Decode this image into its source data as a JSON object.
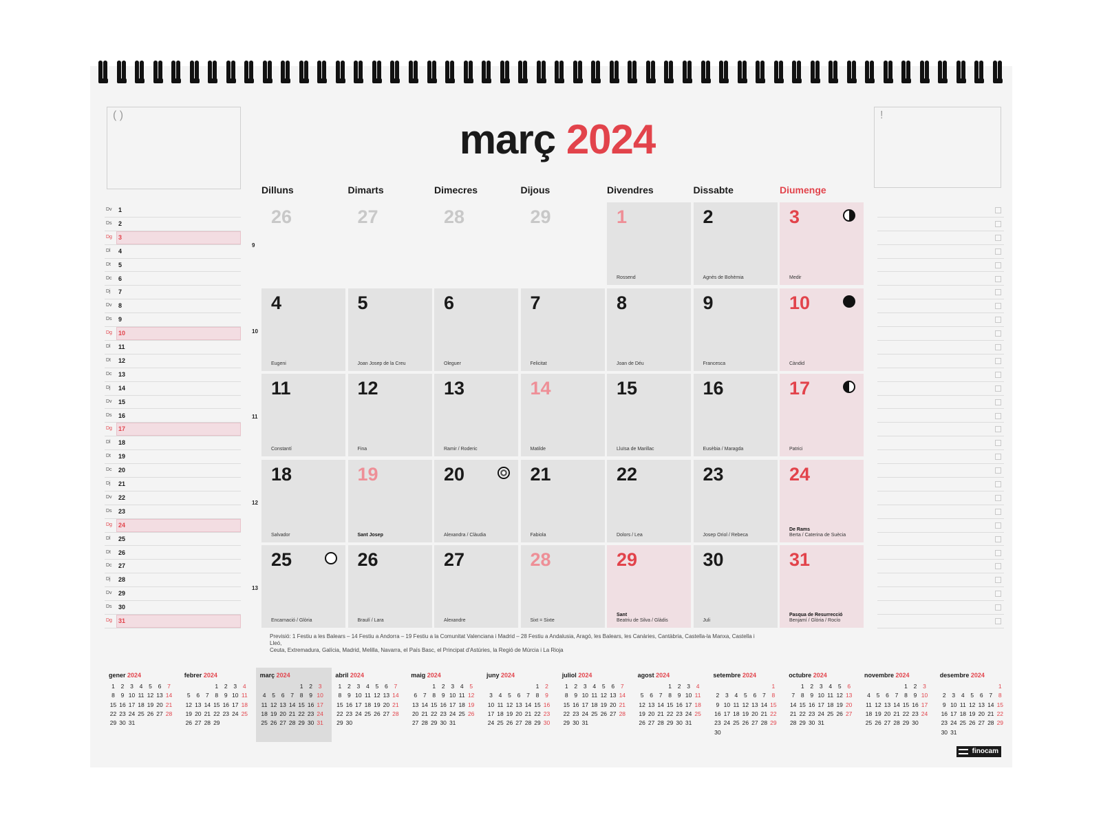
{
  "title": {
    "month": "març",
    "year": "2024"
  },
  "left_box_symbol": "( )",
  "right_box_symbol": "!",
  "weekdays": [
    "Dilluns",
    "Dimarts",
    "Dimecres",
    "Dijous",
    "Divendres",
    "Dissabte",
    "Diumenge"
  ],
  "week_numbers": [
    "9",
    "10",
    "11",
    "12",
    "13"
  ],
  "cells": [
    {
      "num": "26",
      "style": "grey",
      "bg": "empty",
      "saint": ""
    },
    {
      "num": "27",
      "style": "grey",
      "bg": "empty",
      "saint": ""
    },
    {
      "num": "28",
      "style": "grey",
      "bg": "empty",
      "saint": ""
    },
    {
      "num": "29",
      "style": "grey",
      "bg": "empty",
      "saint": ""
    },
    {
      "num": "1",
      "style": "pink",
      "bg": "weekday",
      "saint": "Rossend"
    },
    {
      "num": "2",
      "style": "",
      "bg": "weekday",
      "saint": "Agnès de Bohèmia"
    },
    {
      "num": "3",
      "style": "red",
      "bg": "holiday",
      "saint": "Medir",
      "moon": "half-l"
    },
    {
      "num": "4",
      "style": "",
      "bg": "weekday",
      "saint": "Eugeni"
    },
    {
      "num": "5",
      "style": "",
      "bg": "weekday",
      "saint": "Joan Josep de la Creu"
    },
    {
      "num": "6",
      "style": "",
      "bg": "weekday",
      "saint": "Oleguer"
    },
    {
      "num": "7",
      "style": "",
      "bg": "weekday",
      "saint": "Felicitat"
    },
    {
      "num": "8",
      "style": "",
      "bg": "weekday",
      "saint": "Joan de Déu"
    },
    {
      "num": "9",
      "style": "",
      "bg": "weekday",
      "saint": "Francesca"
    },
    {
      "num": "10",
      "style": "red",
      "bg": "holiday",
      "saint": "Càndid",
      "moon": "full"
    },
    {
      "num": "11",
      "style": "",
      "bg": "weekday",
      "saint": "Constantí"
    },
    {
      "num": "12",
      "style": "",
      "bg": "weekday",
      "saint": "Fina"
    },
    {
      "num": "13",
      "style": "",
      "bg": "weekday",
      "saint": "Ramir / Roderic"
    },
    {
      "num": "14",
      "style": "pink",
      "bg": "weekday",
      "saint": "Matilde"
    },
    {
      "num": "15",
      "style": "",
      "bg": "weekday",
      "saint": "Lluïsa de Marillac"
    },
    {
      "num": "16",
      "style": "",
      "bg": "weekday",
      "saint": "Eusèbia / Maragda"
    },
    {
      "num": "17",
      "style": "red",
      "bg": "holiday",
      "saint": "Patrici",
      "moon": "half-r"
    },
    {
      "num": "18",
      "style": "",
      "bg": "weekday",
      "saint": "Salvador"
    },
    {
      "num": "19",
      "style": "pink",
      "bg": "weekday",
      "saint_bold": "Sant Josep",
      "saint": ""
    },
    {
      "num": "20",
      "style": "",
      "bg": "weekday",
      "saint": "Alexandra / Clàudia",
      "moon": "star"
    },
    {
      "num": "21",
      "style": "",
      "bg": "weekday",
      "saint": "Fabiola"
    },
    {
      "num": "22",
      "style": "",
      "bg": "weekday",
      "saint": "Dolors / Lea"
    },
    {
      "num": "23",
      "style": "",
      "bg": "weekday",
      "saint": "Josep Oriol / Rebeca"
    },
    {
      "num": "24",
      "style": "red",
      "bg": "holiday",
      "saint_bold": "De Rams",
      "saint": "Berta / Caterina de Suècia"
    },
    {
      "num": "25",
      "style": "",
      "bg": "weekday",
      "saint": "Encarnació / Glòria",
      "moon": "new"
    },
    {
      "num": "26",
      "style": "",
      "bg": "weekday",
      "saint": "Braulí / Lara"
    },
    {
      "num": "27",
      "style": "",
      "bg": "weekday",
      "saint": "Alexandre"
    },
    {
      "num": "28",
      "style": "pink",
      "bg": "weekday",
      "saint": "Sixt = Sixte"
    },
    {
      "num": "29",
      "style": "red",
      "bg": "holiday",
      "saint_bold": "Sant",
      "saint": "Beatriu de Silva / Glàdis"
    },
    {
      "num": "30",
      "style": "",
      "bg": "weekday",
      "saint": "Juli"
    },
    {
      "num": "31",
      "style": "red",
      "bg": "holiday",
      "saint_bold": "Pasqua de Resurrecció",
      "saint": "Benjamí / Glòria / Rocío"
    }
  ],
  "left_list": [
    {
      "wd": "Dv",
      "d": "1"
    },
    {
      "wd": "Ds",
      "d": "2"
    },
    {
      "wd": "Dg",
      "d": "3"
    },
    {
      "wd": "Dl",
      "d": "4"
    },
    {
      "wd": "Dt",
      "d": "5"
    },
    {
      "wd": "Dc",
      "d": "6"
    },
    {
      "wd": "Dj",
      "d": "7"
    },
    {
      "wd": "Dv",
      "d": "8"
    },
    {
      "wd": "Ds",
      "d": "9"
    },
    {
      "wd": "Dg",
      "d": "10"
    },
    {
      "wd": "Dl",
      "d": "11"
    },
    {
      "wd": "Dt",
      "d": "12"
    },
    {
      "wd": "Dc",
      "d": "13"
    },
    {
      "wd": "Dj",
      "d": "14"
    },
    {
      "wd": "Dv",
      "d": "15"
    },
    {
      "wd": "Ds",
      "d": "16"
    },
    {
      "wd": "Dg",
      "d": "17"
    },
    {
      "wd": "Dl",
      "d": "18"
    },
    {
      "wd": "Dt",
      "d": "19"
    },
    {
      "wd": "Dc",
      "d": "20"
    },
    {
      "wd": "Dj",
      "d": "21"
    },
    {
      "wd": "Dv",
      "d": "22"
    },
    {
      "wd": "Ds",
      "d": "23"
    },
    {
      "wd": "Dg",
      "d": "24"
    },
    {
      "wd": "Dl",
      "d": "25"
    },
    {
      "wd": "Dt",
      "d": "26"
    },
    {
      "wd": "Dc",
      "d": "27"
    },
    {
      "wd": "Dj",
      "d": "28"
    },
    {
      "wd": "Dv",
      "d": "29"
    },
    {
      "wd": "Ds",
      "d": "30"
    },
    {
      "wd": "Dg",
      "d": "31"
    }
  ],
  "notes_line1": "Previsió: 1 Festiu a les Balears – 14 Festiu a Andorra – 19 Festiu a la Comunitat Valenciana i Madrid – 28 Festiu a Andalusia, Aragó, les Balears, les Canàries, Cantàbria, Castella-la Manxa, Castella i Lleó,",
  "notes_line2": "Ceuta, Extremadura, Galícia, Madrid, Melilla, Navarra, el País Basc, el Principat d'Astúries, la Regió de Múrcia i La Rioja",
  "year_label": "2024",
  "mini_months": [
    {
      "name": "gener",
      "start": 0,
      "days": 31
    },
    {
      "name": "febrer",
      "start": 3,
      "days": 29
    },
    {
      "name": "març",
      "start": 4,
      "days": 31
    },
    {
      "name": "abril",
      "start": 0,
      "days": 30
    },
    {
      "name": "maig",
      "start": 2,
      "days": 31
    },
    {
      "name": "juny",
      "start": 5,
      "days": 30
    },
    {
      "name": "juliol",
      "start": 0,
      "days": 31
    },
    {
      "name": "agost",
      "start": 3,
      "days": 31
    },
    {
      "name": "setembre",
      "start": 6,
      "days": 30
    },
    {
      "name": "octubre",
      "start": 1,
      "days": 31
    },
    {
      "name": "novembre",
      "start": 4,
      "days": 30
    },
    {
      "name": "desembre",
      "start": 6,
      "days": 31
    }
  ],
  "brand": "finocam",
  "colors": {
    "accent": "#e2434b",
    "holiday_bg": "#f0dfe3",
    "cell_bg": "#e3e3e3",
    "sheet": "#f4f4f4"
  }
}
